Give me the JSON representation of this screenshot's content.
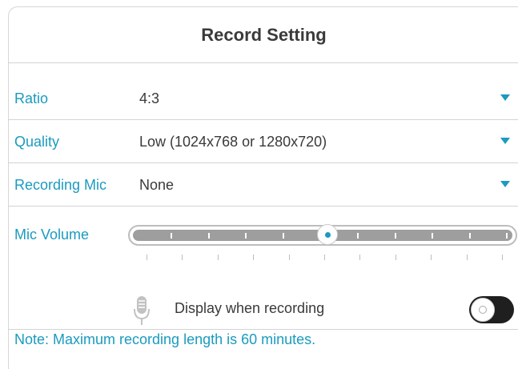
{
  "dialog": {
    "title": "Record Setting"
  },
  "settings": {
    "ratio": {
      "label": "Ratio",
      "value": "4:3"
    },
    "quality": {
      "label": "Quality",
      "value": "Low (1024x768 or 1280x720)"
    },
    "recording_mic": {
      "label": "Recording Mic",
      "value": "None"
    }
  },
  "mic_volume": {
    "label": "Mic Volume",
    "level_fraction": 0.5
  },
  "display_when_recording": {
    "label": "Display when recording",
    "enabled": false
  },
  "note": "Note: Maximum recording length is 60 minutes.",
  "icons": {
    "dropdown": "caret-down-icon",
    "mic": "microphone-icon"
  },
  "colors": {
    "accent": "#1a9bbf",
    "text": "#3a3a3a",
    "divider": "#d3d3d3",
    "slider_track": "#9e9e9e",
    "toggle_off": "#1f1f1f"
  }
}
